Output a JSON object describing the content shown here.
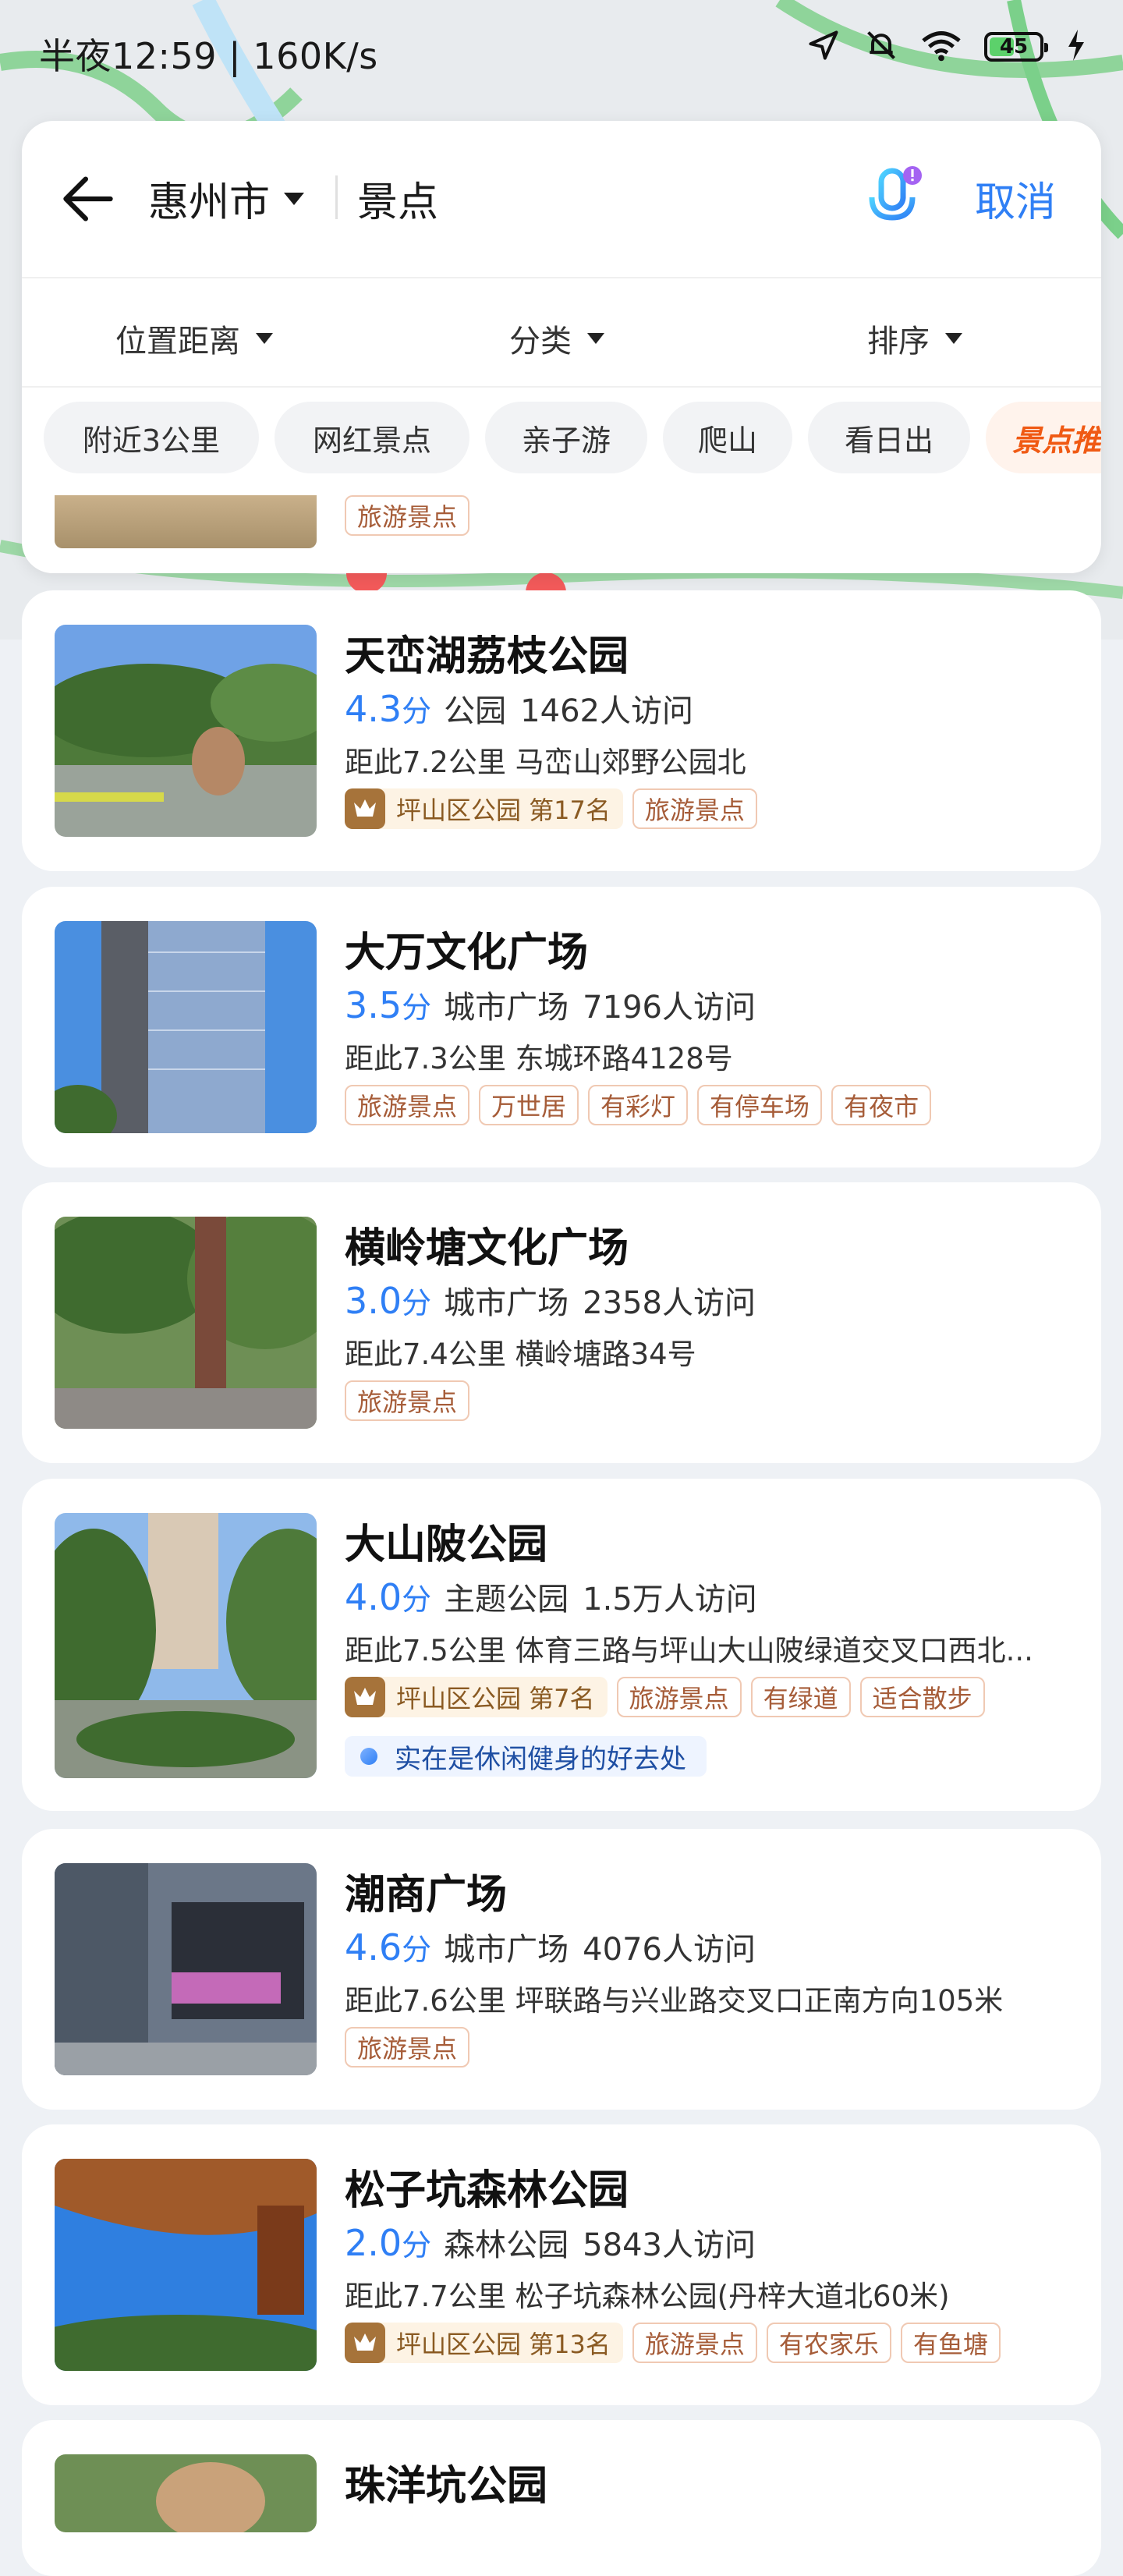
{
  "status": {
    "time": "半夜12:59 | 160K/s",
    "battery": "45",
    "icons": [
      "location-icon",
      "mute-icon",
      "wifi-icon",
      "battery-icon",
      "charging-icon"
    ]
  },
  "search": {
    "city": "惠州市",
    "query": "景点",
    "cancel_label": "取消"
  },
  "filters": [
    "位置距离",
    "分类",
    "排序"
  ],
  "chips": [
    "附近3公里",
    "网红景点",
    "亲子游",
    "爬山",
    "看日出",
    "景点推"
  ],
  "peek_tag": "旅游景点",
  "results": [
    {
      "title": "天峦湖荔枝公园",
      "score": "4.3",
      "score_unit": "分",
      "category": "公园",
      "visits": "1462人访问",
      "address": "距此7.2公里 马峦山郊野公园北",
      "rank": "坪山区公园 第17名",
      "tags": [
        "旅游景点"
      ]
    },
    {
      "title": "大万文化广场",
      "score": "3.5",
      "score_unit": "分",
      "category": "城市广场",
      "visits": "7196人访问",
      "address": "距此7.3公里 东城环路4128号",
      "tags": [
        "旅游景点",
        "万世居",
        "有彩灯",
        "有停车场",
        "有夜市"
      ]
    },
    {
      "title": "横岭塘文化广场",
      "score": "3.0",
      "score_unit": "分",
      "category": "城市广场",
      "visits": "2358人访问",
      "address": "距此7.4公里 横岭塘路34号",
      "tags": [
        "旅游景点"
      ]
    },
    {
      "title": "大山陂公园",
      "score": "4.0",
      "score_unit": "分",
      "category": "主题公园",
      "visits": "1.5万人访问",
      "address": "距此7.5公里 体育三路与坪山大山陂绿道交叉口西北...",
      "rank": "坪山区公园 第7名",
      "tags": [
        "旅游景点",
        "有绿道",
        "适合散步"
      ],
      "review": "实在是休闲健身的好去处"
    },
    {
      "title": "潮商广场",
      "score": "4.6",
      "score_unit": "分",
      "category": "城市广场",
      "visits": "4076人访问",
      "address": "距此7.6公里 坪联路与兴业路交叉口正南方向105米",
      "tags": [
        "旅游景点"
      ]
    },
    {
      "title": "松子坑森林公园",
      "score": "2.0",
      "score_unit": "分",
      "category": "森林公园",
      "visits": "5843人访问",
      "address": "距此7.7公里 松子坑森林公园(丹梓大道北60米)",
      "rank": "坪山区公园 第13名",
      "tags": [
        "旅游景点",
        "有农家乐",
        "有鱼塘"
      ]
    },
    {
      "title": "珠洋坑公园"
    }
  ],
  "colors": {
    "accent": "#2f7ff5",
    "hot_chip": "#f05a14",
    "tag_border": "#f0c9b3",
    "tag_text": "#a65c38"
  }
}
